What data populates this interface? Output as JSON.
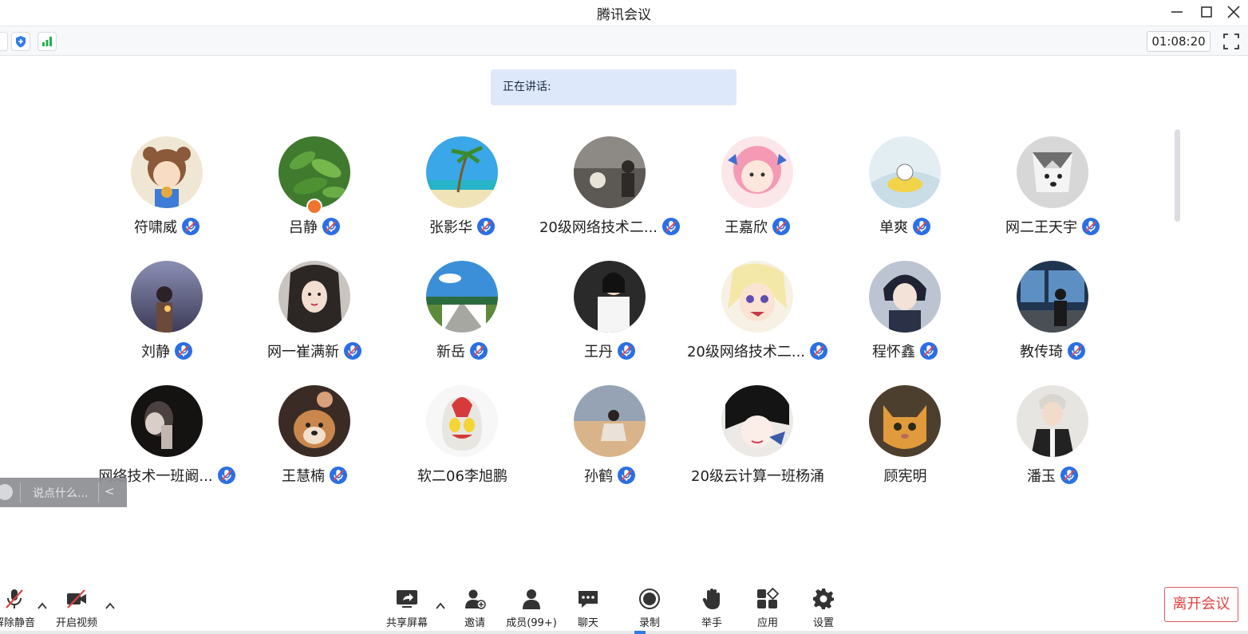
{
  "window": {
    "title": "腾讯会议"
  },
  "toolbar": {
    "timer": "01:08:20",
    "icons": [
      "settings-partial-icon",
      "security-shield-icon",
      "network-signal-icon",
      "fullscreen-icon"
    ]
  },
  "speaking": {
    "label": "正在讲话:"
  },
  "participants": [
    {
      "name": "符啸威",
      "muted": true
    },
    {
      "name": "吕静",
      "muted": true,
      "host": true
    },
    {
      "name": "张影华",
      "muted": true
    },
    {
      "name": "20级网络技术二...",
      "muted": true
    },
    {
      "name": "王嘉欣",
      "muted": true
    },
    {
      "name": "单爽",
      "muted": true
    },
    {
      "name": "网二王天宇",
      "muted": true
    },
    {
      "name": "刘静",
      "muted": true
    },
    {
      "name": "网一崔满新",
      "muted": true
    },
    {
      "name": "新岳",
      "muted": true
    },
    {
      "name": "王丹",
      "muted": true
    },
    {
      "name": "20级网络技术二...",
      "muted": true
    },
    {
      "name": "程怀鑫",
      "muted": true
    },
    {
      "name": "教传琦",
      "muted": true
    },
    {
      "name": "网络技术一班阚...",
      "muted": true
    },
    {
      "name": "王慧楠",
      "muted": true
    },
    {
      "name": "软二06李旭鹏",
      "muted": false
    },
    {
      "name": "孙鹤",
      "muted": true
    },
    {
      "name": "20级云计算一班杨涌",
      "muted": false
    },
    {
      "name": "顾宪明",
      "muted": false
    },
    {
      "name": "潘玉",
      "muted": true
    }
  ],
  "quick_chat": {
    "placeholder": "说点什么..."
  },
  "bottom": {
    "unmute_label": "解除静音",
    "video_label": "开启视频",
    "share_label": "共享屏幕",
    "invite_label": "邀请",
    "members_label": "成员(99+)",
    "chat_label": "聊天",
    "record_label": "录制",
    "raise_label": "举手",
    "apps_label": "应用",
    "settings_label": "设置",
    "leave_label": "离开会议"
  },
  "colors": {
    "accent": "#2f7bea",
    "speaking_bg": "#dde9fb",
    "leave": "#e0403f",
    "mic_muted_badge": "#2b6fe5"
  }
}
